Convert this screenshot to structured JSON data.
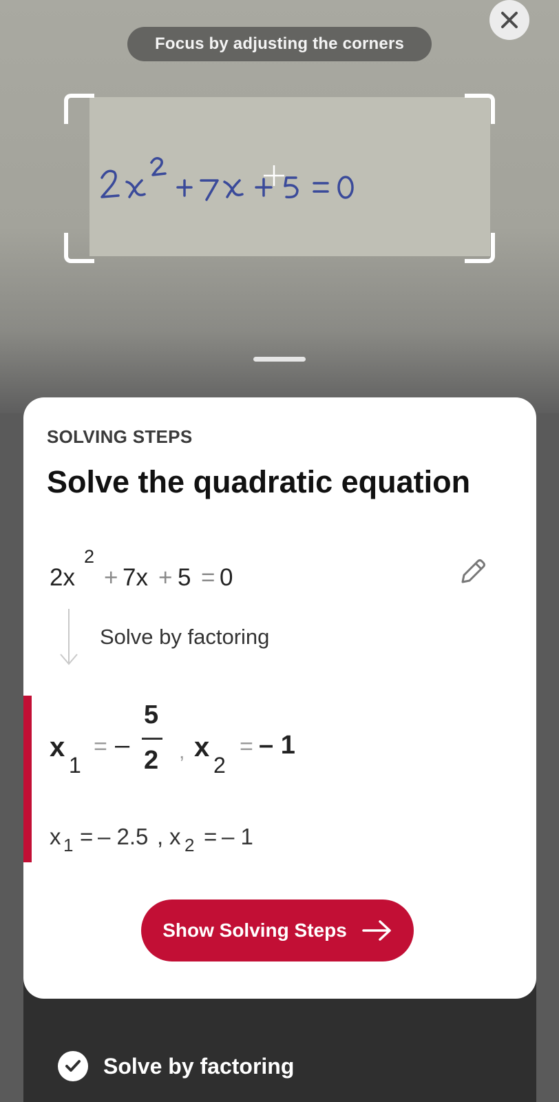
{
  "camera": {
    "hint": "Focus by adjusting the corners",
    "captured_equation": "2x² + 7x + 5 = 0"
  },
  "card": {
    "section_label": "SOLVING STEPS",
    "title": "Solve the quadratic equation",
    "problem": {
      "coef": "2x",
      "exp": "2",
      "plus1": "+",
      "term2": "7x",
      "plus2": "+",
      "const": "5",
      "eq": "=",
      "rhs": "0"
    },
    "step_label": "Solve by factoring",
    "result": {
      "x1": "x",
      "sub1": "1",
      "eq1": "=",
      "minus": "–",
      "num": "5",
      "den": "2",
      "comma": ",",
      "x2": "x",
      "sub2": "2",
      "eq2": "=",
      "val2": "– 1"
    },
    "decimal": {
      "x1": "x",
      "sub1": "1",
      "eq1": "=",
      "val1": "– 2.5",
      "comma": ",",
      "x2": "x",
      "sub2": "2",
      "eq2": "=",
      "val2": "– 1"
    },
    "button_label": "Show Solving Steps"
  },
  "method": {
    "label": "Solve by factoring"
  },
  "colors": {
    "accent": "#c20f35",
    "card_bg": "#ffffff",
    "sheet_bg": "#2f2f2f"
  },
  "icons": [
    "close-icon",
    "edit-pencil-icon",
    "down-arrow-icon",
    "arrow-right-icon",
    "check-icon"
  ]
}
